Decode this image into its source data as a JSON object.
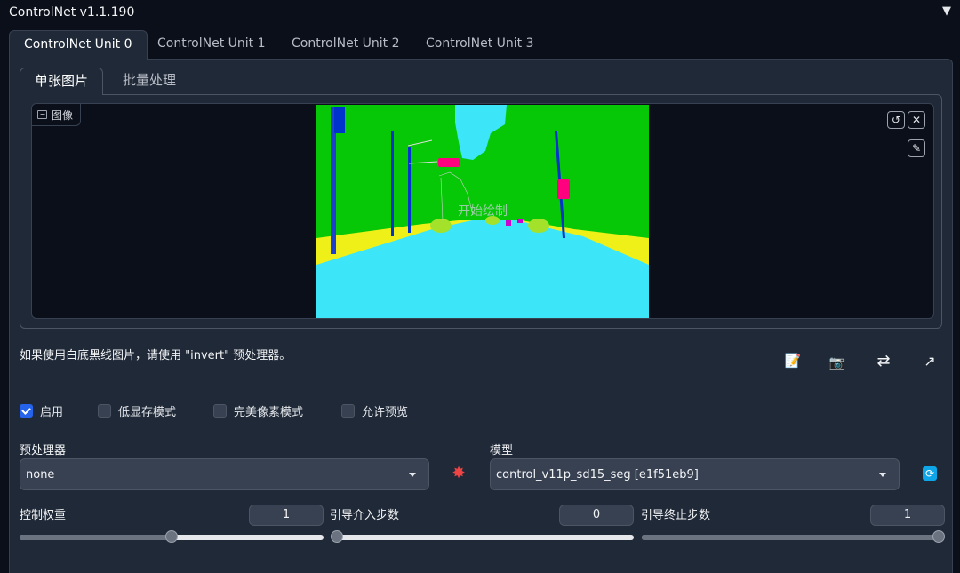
{
  "accordion": {
    "title": "ControlNet v1.1.190",
    "toggle": "▼"
  },
  "unit_tabs": [
    {
      "label": "ControlNet Unit 0",
      "active": true
    },
    {
      "label": "ControlNet Unit 1",
      "active": false
    },
    {
      "label": "ControlNet Unit 2",
      "active": false
    },
    {
      "label": "ControlNet Unit 3",
      "active": false
    }
  ],
  "mode_tabs": [
    {
      "label": "单张图片",
      "active": true
    },
    {
      "label": "批量处理",
      "active": false
    }
  ],
  "image_block": {
    "label": "图像",
    "overlay_text": "开始绘制",
    "colors": {
      "sky": "#3ce6f8",
      "vegetation": "#07c806",
      "road": "#3ce6f8",
      "sidewalk": "#f0f019",
      "pole": "#0033cc",
      "sign": "#ff007f",
      "car": "#a4e12b"
    }
  },
  "hint": "如果使用白底黑线图片，请使用 \"invert\" 预处理器。",
  "checkboxes": [
    {
      "label": "启用",
      "checked": true
    },
    {
      "label": "低显存模式",
      "checked": false
    },
    {
      "label": "完美像素模式",
      "checked": false
    },
    {
      "label": "允许预览",
      "checked": false
    }
  ],
  "preprocessor": {
    "label": "预处理器",
    "value": "none"
  },
  "model": {
    "label": "模型",
    "value": "control_v11p_sd15_seg [e1f51eb9]"
  },
  "sliders": [
    {
      "label": "控制权重",
      "value": "1",
      "fraction": 0.5
    },
    {
      "label": "引导介入步数",
      "value": "0",
      "fraction": 0.0
    },
    {
      "label": "引导终止步数",
      "value": "1",
      "fraction": 1.0
    }
  ],
  "icons": {
    "undo": "↺",
    "clear": "✕",
    "brush": "✎",
    "explode": "✸",
    "refresh": "⟳",
    "new_canvas": "📝",
    "camera": "📷",
    "swap": "⇄",
    "send": "↗"
  }
}
